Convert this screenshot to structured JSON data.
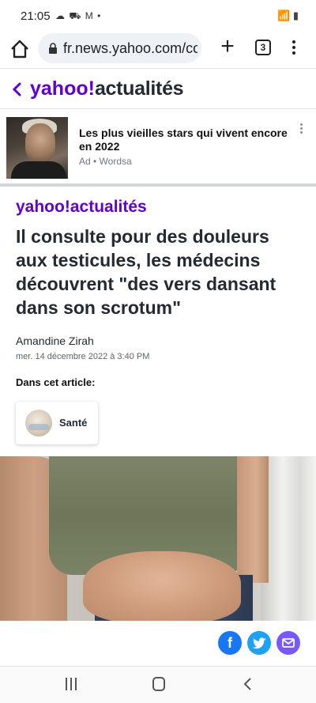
{
  "status_bar": {
    "time": "21:05",
    "left_icons": "☁ ⛟ M •",
    "right_icons": "📶 ▮"
  },
  "browser": {
    "url": "fr.news.yahoo.com/cc",
    "tab_count": "3"
  },
  "site_header": {
    "brand": "yahoo!",
    "section": "actualités"
  },
  "ad": {
    "title": "Les plus vieilles stars qui vivent encore en 2022",
    "meta": "Ad • Wordsa"
  },
  "article": {
    "brand": "yahoo!",
    "section": "actualités",
    "headline": "Il consulte pour des douleurs aux testicules, les médecins découvrent \"des vers dansant dans son scrotum\"",
    "author": "Amandine Zirah",
    "date": "mer. 14 décembre 2022 à 3:40 PM",
    "in_article_label": "Dans cet article:",
    "topic": "Santé"
  },
  "share": {
    "facebook": "f",
    "twitter": "🐦",
    "mail": "✉"
  },
  "colors": {
    "brand_purple": "#6001d2",
    "facebook": "#1877f2",
    "twitter": "#1da1f2",
    "mail": "#7759ff"
  }
}
